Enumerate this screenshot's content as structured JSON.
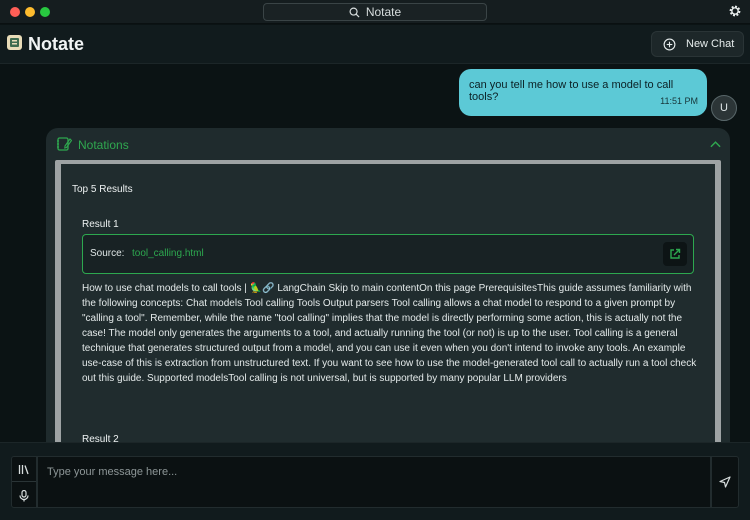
{
  "window": {
    "search_label": "Notate"
  },
  "header": {
    "app_title": "Notate",
    "new_chat_label": "New Chat"
  },
  "conversation": {
    "user_message": {
      "text": "can you tell me how to use a model to call tools?",
      "time": "11:51 PM",
      "avatar_letter": "U"
    }
  },
  "notations": {
    "title": "Notations",
    "results_heading": "Top 5 Results",
    "results": [
      {
        "title": "Result 1",
        "source_label": "Source:",
        "source_file": "tool_calling.html",
        "text": "How to use chat models to call tools | 🦜️🔗 LangChain Skip to main contentOn this page PrerequisitesThis guide assumes familiarity with the following concepts: Chat models Tool calling Tools Output parsers Tool calling allows a chat model to respond to a given prompt by \"calling a tool\". Remember, while the name \"tool calling\" implies that the model is directly performing some action, this is actually not the case! The model only generates the arguments to a tool, and actually running the tool (or not) is up to the user. Tool calling is a general technique that generates structured output from a model, and you can use it even when you don't intend to invoke any tools. An example use-case of this is extraction from unstructured text. If you want to see how to use the model-generated tool call to actually run a tool check out this guide. Supported modelsTool calling is not universal, but is supported by many popular LLM providers"
      },
      {
        "title": "Result 2"
      }
    ]
  },
  "composer": {
    "placeholder": "Type your message here..."
  },
  "colors": {
    "accent_green": "#2da84f",
    "user_bubble": "#5cc9d6",
    "background": "#0b1314"
  },
  "icons": {
    "search": "search-icon",
    "settings": "gear-icon",
    "new_chat": "plus-circle-icon",
    "notations": "notebook-icon",
    "collapse": "chevron-up-icon",
    "open_source": "external-link-icon",
    "library": "library-icon",
    "mic": "microphone-icon",
    "send": "send-icon"
  }
}
